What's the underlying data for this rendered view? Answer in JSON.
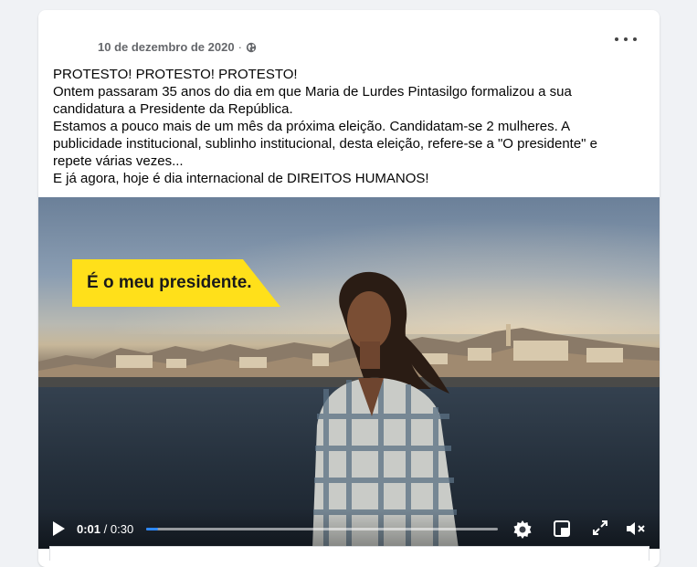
{
  "post": {
    "date": "10 de dezembro de 2020",
    "separator": "·",
    "privacy_icon": "globe-icon",
    "more_icon": "more-options-icon",
    "lines": [
      "PROTESTO! PROTESTO! PROTESTO!",
      "Ontem passaram 35 anos do dia em que Maria de Lurdes Pintasilgo formalizou a sua candidatura a Presidente da República.",
      "Estamos a pouco mais de um mês da próxima eleição. Candidatam-se 2 mulheres. A publicidade institucional, sublinho institucional, desta eleição, refere-se a \"O presidente\" e repete várias vezes...",
      "E já agora, hoje é dia internacional de DIREITOS HUMANOS!"
    ]
  },
  "video": {
    "banner_text": "É o meu presidente.",
    "banner_color": "#ffe01a",
    "current_time": "0:01",
    "time_separator": "/",
    "duration": "0:30",
    "progress_fraction": 0.033,
    "accent": "#2d88ff",
    "icons": [
      "play-icon",
      "settings-icon",
      "picture-in-picture-icon",
      "fullscreen-icon",
      "muted-volume-icon"
    ]
  }
}
